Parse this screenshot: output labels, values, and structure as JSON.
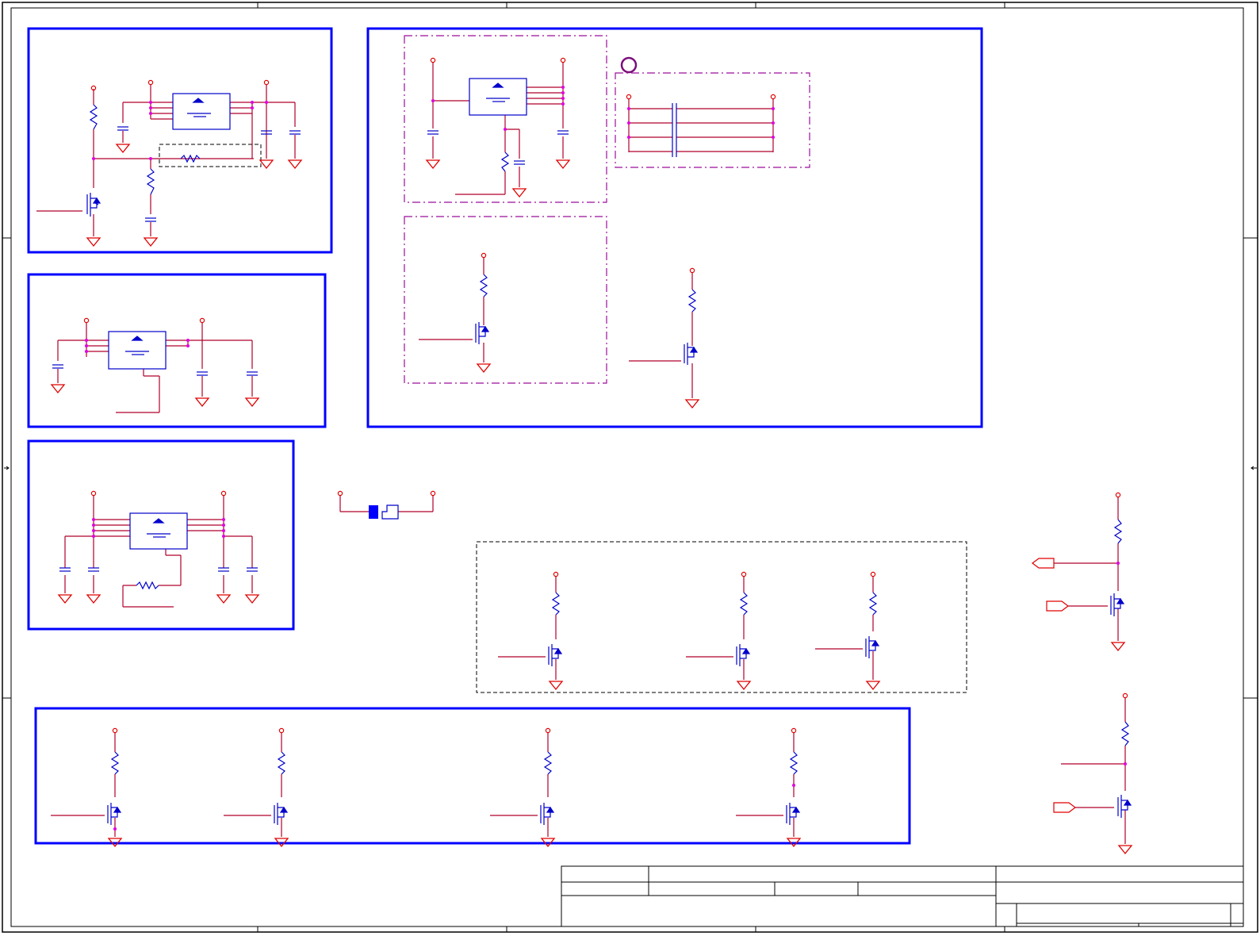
{
  "document": {
    "kind": "schematic-sheet",
    "visible_text": []
  },
  "title_block": {
    "cells": [
      "",
      "",
      "",
      "",
      "",
      "",
      "",
      ""
    ]
  },
  "colors": {
    "frame": "#000000",
    "block_border": "#0000ff",
    "wire": "#b0002a",
    "power": "#e00000",
    "component": "#0000cc",
    "junction": "#e000e0",
    "dashed_group": "#9b0f9b",
    "ground": "#e00000"
  },
  "icons": {
    "power_pin": "power-pin-icon",
    "ground": "ground-icon",
    "resistor": "resistor-icon",
    "capacitor": "capacitor-icon",
    "mosfet": "mosfet-icon",
    "regulator": "regulator-icon",
    "connector_port": "port-icon"
  }
}
